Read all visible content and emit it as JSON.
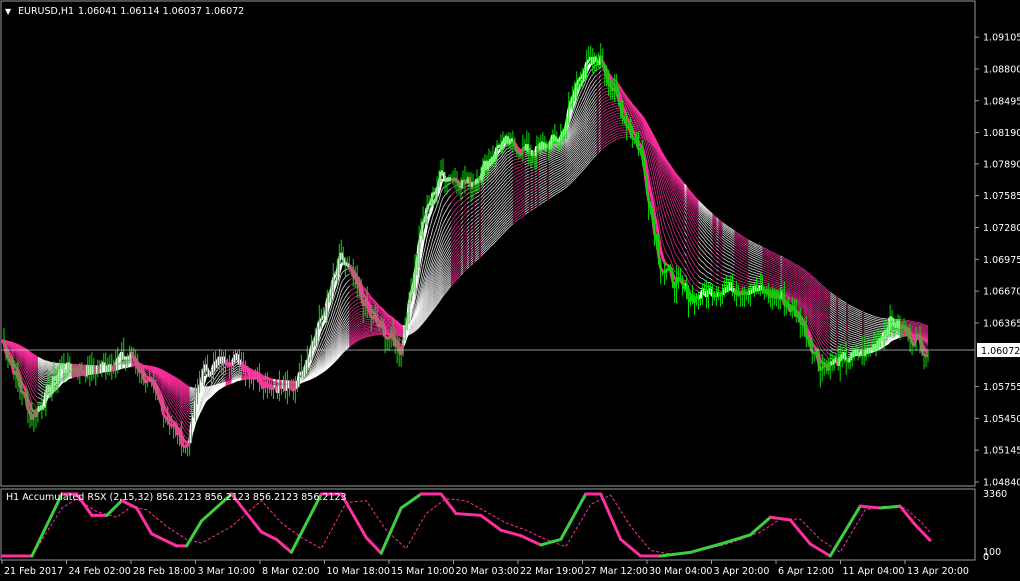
{
  "main_header": {
    "symbol": "EURUSD,H1",
    "ohlc": "1.06041 1.06114 1.06037 1.06072"
  },
  "indicator_header": {
    "label": "H1 Accumulated RSX (2,15,32) 856.2123 856.2123 856.2123 856.2123"
  },
  "current_price": "1.06072",
  "colors": {
    "background": "#000000",
    "frame": "#9a9a9a",
    "candles": "#00e000",
    "ribbon_up": "#ffffff",
    "ribbon_down": "#ff2fa0",
    "rsx_up": "#3ecf3e",
    "rsx_down": "#ff2fa0",
    "signal_dashed": "#ff2fa0",
    "price_line": "#c8c8c8"
  },
  "icons": {
    "collapse": "triangle-down-icon"
  },
  "chart_data": [
    {
      "type": "line",
      "symbol": "EURUSD",
      "timeframe": "H1",
      "ylim": [
        1.0484,
        1.0925
      ],
      "y_ticks": [
        "1.09105",
        "1.08800",
        "1.08495",
        "1.08190",
        "1.07890",
        "1.07585",
        "1.07280",
        "1.06975",
        "1.06670",
        "1.06365",
        "1.06072",
        "1.05755",
        "1.05450",
        "1.05145",
        "1.04840"
      ],
      "x_ticks": [
        "21 Feb 2017",
        "24 Feb 02:00",
        "28 Feb 18:00",
        "3 Mar 10:00",
        "8 Mar 02:00",
        "10 Mar 18:00",
        "15 Mar 10:00",
        "20 Mar 03:00",
        "22 Mar 19:00",
        "27 Mar 12:00",
        "30 Mar 04:00",
        "3 Apr 20:00",
        "6 Apr 12:00",
        "11 Apr 04:00",
        "13 Apr 20:00"
      ],
      "series": [
        {
          "name": "EURUSD,H1",
          "x": [
            0,
            30,
            60,
            90,
            110,
            130,
            160,
            185,
            200,
            230,
            260,
            290,
            320,
            340,
            370,
            400,
            420,
            440,
            470,
            500,
            530,
            560,
            580,
            600,
            620,
            640,
            660,
            690,
            720,
            750,
            780,
            800,
            820,
            840,
            870,
            890,
            910,
            930
          ],
          "values": [
            1.062,
            1.0545,
            1.0595,
            1.059,
            1.06,
            1.0605,
            1.0555,
            1.0515,
            1.059,
            1.0605,
            1.0582,
            1.057,
            1.064,
            1.07,
            1.064,
            1.061,
            1.073,
            1.078,
            1.077,
            1.081,
            1.08,
            1.0815,
            1.088,
            1.089,
            1.084,
            1.08,
            1.069,
            1.066,
            1.067,
            1.067,
            1.066,
            1.064,
            1.0595,
            1.06,
            1.061,
            1.064,
            1.0625,
            1.0607
          ]
        }
      ]
    },
    {
      "type": "line",
      "ylim": [
        0,
        3360
      ],
      "y_ticks": [
        "3360",
        "100",
        "0"
      ],
      "series": [
        {
          "name": "H1 Accumulated RSX (2,15,32)",
          "x": [
            0,
            30,
            60,
            75,
            90,
            105,
            120,
            135,
            150,
            175,
            185,
            200,
            230,
            260,
            275,
            290,
            320,
            340,
            365,
            380,
            400,
            420,
            440,
            455,
            480,
            500,
            520,
            540,
            560,
            585,
            600,
            620,
            640,
            660,
            690,
            720,
            750,
            770,
            790,
            810,
            830,
            860,
            880,
            900,
            915,
            930
          ],
          "values": [
            0,
            0,
            3360,
            3360,
            2200,
            2200,
            3000,
            2600,
            1200,
            550,
            550,
            1900,
            3360,
            1300,
            900,
            200,
            3360,
            3360,
            1000,
            150,
            2600,
            3360,
            3360,
            2300,
            2200,
            1400,
            1100,
            600,
            900,
            3360,
            3360,
            900,
            0,
            0,
            200,
            650,
            1150,
            2100,
            1950,
            650,
            0,
            2700,
            2600,
            2700,
            1700,
            856
          ]
        },
        {
          "name": "signal",
          "x": [
            0,
            30,
            60,
            75,
            95,
            115,
            130,
            145,
            165,
            185,
            200,
            230,
            260,
            280,
            300,
            320,
            345,
            365,
            385,
            405,
            425,
            445,
            465,
            485,
            505,
            525,
            545,
            565,
            590,
            610,
            630,
            650,
            670,
            700,
            730,
            760,
            780,
            800,
            820,
            840,
            865,
            885,
            905,
            920,
            930
          ],
          "values": [
            0,
            0,
            2600,
            3100,
            2400,
            2100,
            2700,
            2500,
            1600,
            900,
            700,
            1600,
            3000,
            1800,
            1000,
            400,
            2900,
            3000,
            1400,
            400,
            2300,
            3100,
            3000,
            2400,
            1800,
            1400,
            900,
            500,
            2800,
            3300,
            1600,
            300,
            100,
            300,
            700,
            1300,
            2000,
            2000,
            900,
            200,
            2500,
            2700,
            2600,
            1900,
            1300
          ]
        }
      ]
    }
  ]
}
